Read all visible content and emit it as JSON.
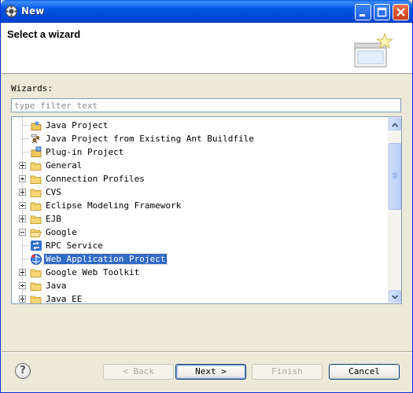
{
  "window": {
    "title": "New",
    "controls": [
      "minimize-icon",
      "maximize-icon",
      "close-icon"
    ]
  },
  "header": {
    "title": "Select a wizard",
    "banner_icon": "new-wizard-banner-icon"
  },
  "wizards_label": "Wizards:",
  "filter": {
    "placeholder": "type filter text",
    "value": ""
  },
  "tree": {
    "items": [
      {
        "label": "Java Project",
        "level": 1,
        "icon": "java-project-icon"
      },
      {
        "label": "Java Project from Existing Ant Buildfile",
        "level": 1,
        "icon": "ant-project-icon"
      },
      {
        "label": "Plug-in Project",
        "level": 1,
        "icon": "plugin-project-icon"
      },
      {
        "label": "General",
        "level": 0,
        "icon": "folder-icon",
        "expanded": false
      },
      {
        "label": "Connection Profiles",
        "level": 0,
        "icon": "folder-icon",
        "expanded": false
      },
      {
        "label": "CVS",
        "level": 0,
        "icon": "folder-icon",
        "expanded": false
      },
      {
        "label": "Eclipse Modeling Framework",
        "level": 0,
        "icon": "folder-icon",
        "expanded": false
      },
      {
        "label": "EJB",
        "level": 0,
        "icon": "folder-icon",
        "expanded": false
      },
      {
        "label": "Google",
        "level": 0,
        "icon": "folder-open-icon",
        "expanded": true
      },
      {
        "label": "RPC Service",
        "level": 1,
        "icon": "rpc-service-icon"
      },
      {
        "label": "Web Application Project",
        "level": 1,
        "icon": "google-web-app-icon",
        "selected": true
      },
      {
        "label": "Google Web Toolkit",
        "level": 0,
        "icon": "folder-icon",
        "expanded": false
      },
      {
        "label": "Java",
        "level": 0,
        "icon": "folder-icon",
        "expanded": false
      },
      {
        "label": "Java EE",
        "level": 0,
        "icon": "folder-icon",
        "expanded": false
      }
    ]
  },
  "buttons": {
    "help": "?",
    "back": "< Back",
    "next": "Next >",
    "finish": "Finish",
    "cancel": "Cancel"
  },
  "colors": {
    "title_bar": "#0054e3",
    "selection": "#316ac5",
    "dialog_bg": "#ece9d8"
  }
}
